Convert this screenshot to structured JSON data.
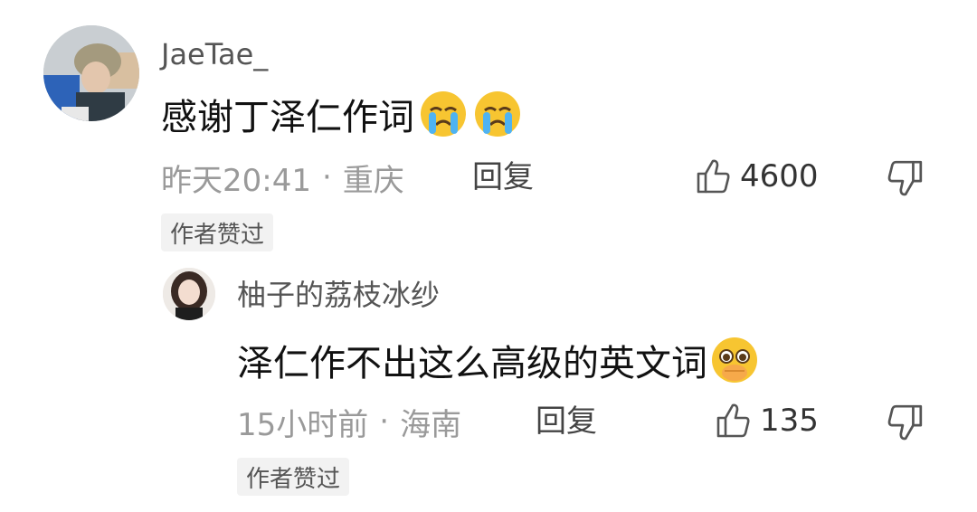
{
  "comments": [
    {
      "username": "JaeTae_",
      "text": "感谢丁泽仁作词",
      "emoji_icons": [
        "crying-face-icon",
        "crying-face-icon"
      ],
      "time": "昨天20:41",
      "separator": "·",
      "location": "重庆",
      "reply_label": "回复",
      "like_count": "4600",
      "badge": "作者赞过"
    }
  ],
  "replies": [
    {
      "username": "柚子的荔枝冰纱",
      "text": "泽仁作不出这么高级的英文词",
      "emoji_icons": [
        "pleading-face-icon"
      ],
      "time": "15小时前",
      "separator": "·",
      "location": "海南",
      "reply_label": "回复",
      "like_count": "135",
      "badge": "作者赞过"
    }
  ],
  "colors": {
    "meta": "#9a9a9a",
    "badge_bg": "#f2f2f2",
    "emoji_yellow": "#f7c531"
  }
}
